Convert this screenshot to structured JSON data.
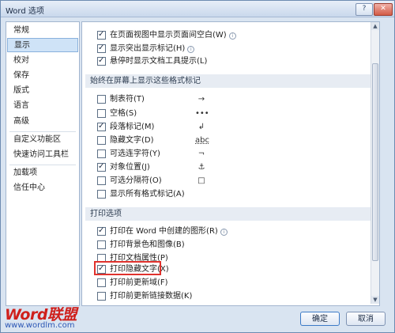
{
  "window": {
    "title": "Word 选项",
    "help_label": "?",
    "close_label": "✕"
  },
  "sidebar": {
    "items": [
      {
        "label": "常规"
      },
      {
        "label": "显示"
      },
      {
        "label": "校对"
      },
      {
        "label": "保存"
      },
      {
        "label": "版式"
      },
      {
        "label": "语言"
      },
      {
        "label": "高级"
      },
      {
        "label": "自定义功能区"
      },
      {
        "label": "快速访问工具栏"
      },
      {
        "label": "加载项"
      },
      {
        "label": "信任中心"
      }
    ],
    "active_index": 1
  },
  "top_options": [
    {
      "label": "在页面视图中显示页面间空白(W)",
      "checked": true,
      "info": true
    },
    {
      "label": "显示突出显示标记(H)",
      "checked": true,
      "info": true
    },
    {
      "label": "悬停时显示文档工具提示(L)",
      "checked": true,
      "info": false
    }
  ],
  "format_section": {
    "header": "始终在屏幕上显示这些格式标记",
    "options": [
      {
        "label": "制表符(T)",
        "checked": false,
        "symbol": "→"
      },
      {
        "label": "空格(S)",
        "checked": false,
        "symbol": "•••"
      },
      {
        "label": "段落标记(M)",
        "checked": true,
        "symbol": "↲"
      },
      {
        "label": "隐藏文字(D)",
        "checked": false,
        "symbol": "abc"
      },
      {
        "label": "可选连字符(Y)",
        "checked": false,
        "symbol": "¬"
      },
      {
        "label": "对象位置(J)",
        "checked": true,
        "symbol": "⚓"
      },
      {
        "label": "可选分隔符(O)",
        "checked": false,
        "symbol": "□"
      },
      {
        "label": "显示所有格式标记(A)",
        "checked": false,
        "symbol": ""
      }
    ]
  },
  "print_section": {
    "header": "打印选项",
    "options": [
      {
        "label": "打印在 Word 中创建的图形(R)",
        "checked": true,
        "info": true
      },
      {
        "label": "打印背景色和图像(B)",
        "checked": false,
        "info": false
      },
      {
        "label": "打印文档属性(P)",
        "checked": false,
        "info": false
      },
      {
        "label": "打印隐藏文字(X)",
        "checked": true,
        "info": false
      },
      {
        "label": "打印前更新域(F)",
        "checked": false,
        "info": false
      },
      {
        "label": "打印前更新链接数据(K)",
        "checked": false,
        "info": false
      }
    ]
  },
  "footer": {
    "ok_label": "确定",
    "cancel_label": "取消"
  },
  "watermark": {
    "brand": "Word联盟",
    "url": "www.wordlm.com"
  },
  "colors": {
    "highlight_border": "#e0322d",
    "active_nav": "#cfe3f7",
    "watermark_red": "#cf1f1b",
    "watermark_blue": "#2c57b5"
  }
}
